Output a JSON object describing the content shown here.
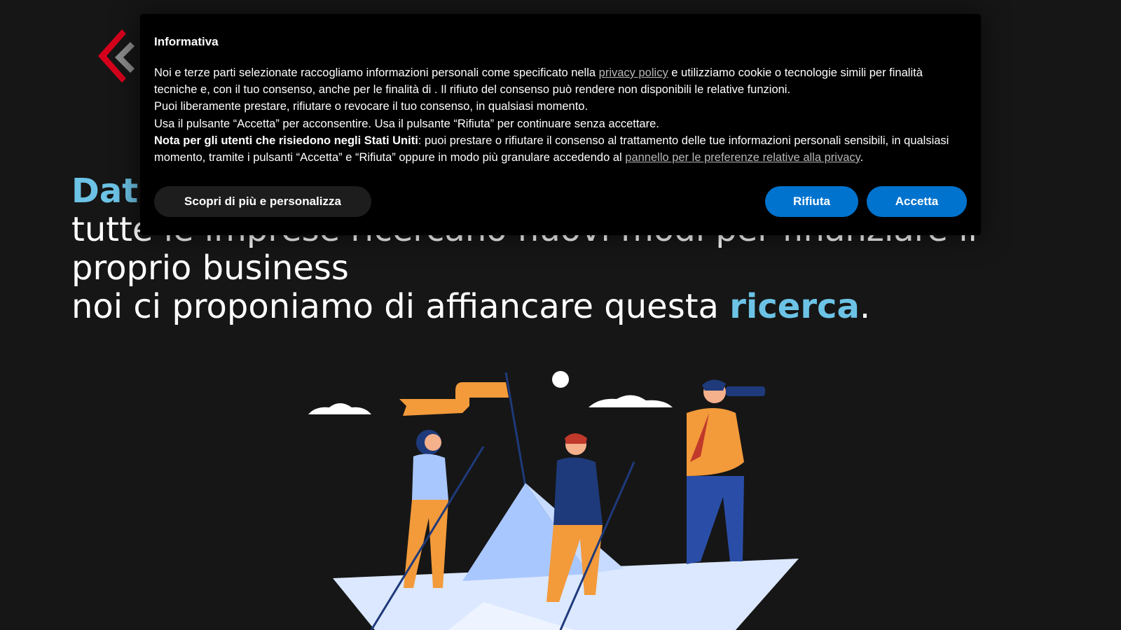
{
  "hero": {
    "word_visible": "Dat",
    "line1": "tutte le imprese ricercano nuovi modi per finanziare il",
    "line2": "proprio business",
    "line3_prefix": "noi ci proponiamo di affiancare questa ",
    "line3_accent": "ricerca",
    "line3_suffix": "."
  },
  "cookie": {
    "title": "Informativa",
    "p1_a": "Noi e terze parti selezionate raccogliamo informazioni personali come specificato nella ",
    "p1_link": "privacy policy",
    "p1_b": " e utilizziamo cookie o tecnologie simili per finalità tecniche e, con il tuo consenso, anche per le finalità di . Il rifiuto del consenso può rendere non disponibili le relative funzioni.",
    "p2": "Puoi liberamente prestare, rifiutare o revocare il tuo consenso, in qualsiasi momento.",
    "p3": "Usa il pulsante “Accetta” per acconsentire. Usa il pulsante “Rifiuta” per continuare senza accettare.",
    "p4_bold": "Nota per gli utenti che risiedono negli Stati Uniti",
    "p4_text": ": puoi prestare o rifiutare il consenso al trattamento delle tue informazioni personali sensibili, in qualsiasi momento, tramite i pulsanti “Accetta” e “Rifiuta” oppure in modo più granulare accedendo al ",
    "p4_link": "pannello per le preferenze relative alla privacy",
    "p4_end": ".",
    "btn_more": "Scopri di più e personalizza",
    "btn_reject": "Rifiuta",
    "btn_accept": "Accetta"
  },
  "colors": {
    "background": "#161616",
    "accent": "#6cc3e6",
    "button_blue": "#0073ce",
    "logo_red": "#d6001c"
  },
  "icons": {
    "logo": "diamond-logo-icon",
    "header_right": "circle-icon"
  }
}
